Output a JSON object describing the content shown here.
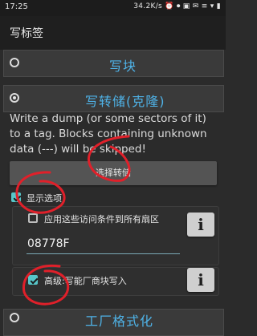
{
  "status_bar": {
    "time": "17:25",
    "indicators": "34.2K/s ⏰ ⏺ ▣ ✉ ≡ ▾ ▮"
  },
  "toolbar": {
    "title": "写标签"
  },
  "sections": {
    "write_block": {
      "title": "写块",
      "selected": false
    },
    "write_dump": {
      "title": "写转储(克隆)",
      "selected": true
    },
    "factory_format": {
      "title": "工厂格式化",
      "selected": false
    }
  },
  "description": "Write a dump (or some sectors of it) to a tag. Blocks containing unknown data (---) will be skipped!",
  "select_dump_button": "选择转储",
  "show_options": {
    "label": "显示选项",
    "checked": true
  },
  "apply_access_conditions": {
    "label": "应用这些访问条件到所有扇区",
    "checked": false
  },
  "access_conditions_value": "08778F",
  "advanced_write": {
    "label": "高级:写入测试能力厂商块写入",
    "visible_label": "高级:写能厂商块写入",
    "checked": true
  },
  "info_icon": "i",
  "colors": {
    "background": "#2b2b2b",
    "accent_title": "#4fb3e8",
    "checkbox_checked": "#57c6c9",
    "annotation": "#e0202a"
  }
}
